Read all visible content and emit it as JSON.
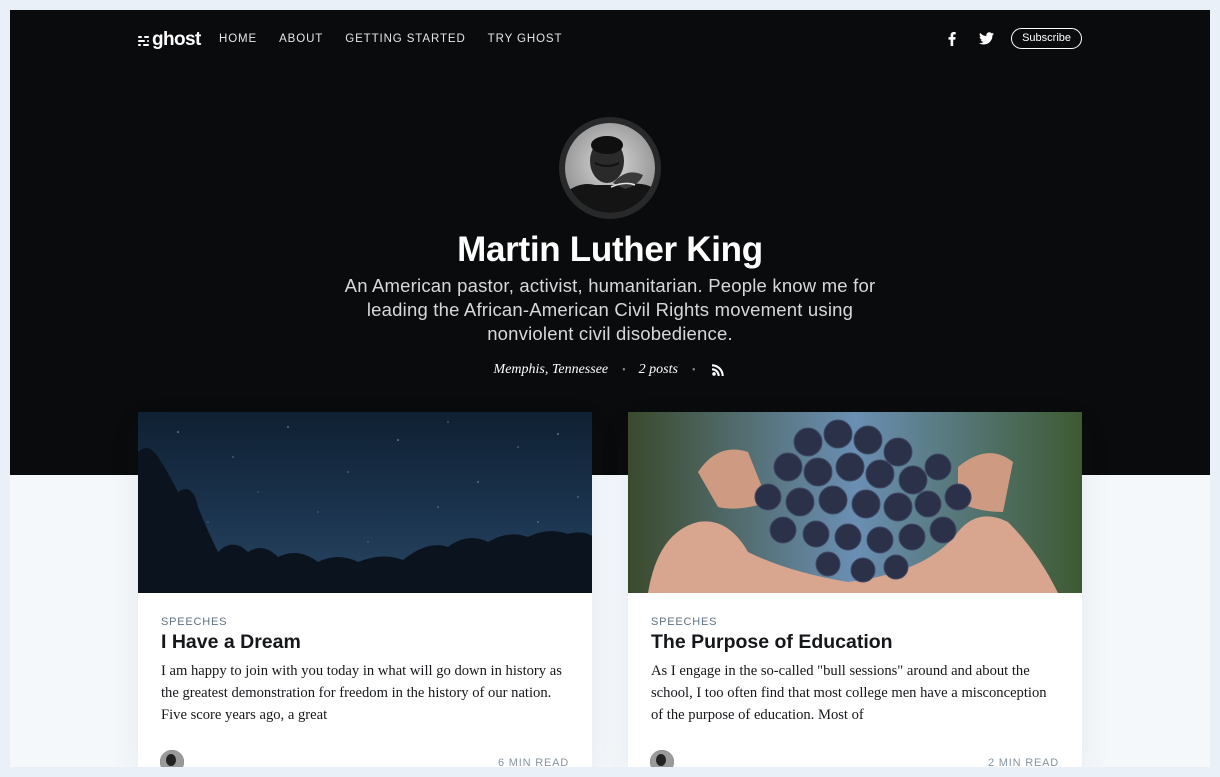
{
  "nav": {
    "logo_text": "ghost",
    "links": [
      "HOME",
      "ABOUT",
      "GETTING STARTED",
      "TRY GHOST"
    ],
    "subscribe_label": "Subscribe"
  },
  "author": {
    "name": "Martin Luther King",
    "bio": "An American pastor, activist, humanitarian. People know me for leading the African-American Civil Rights movement using nonviolent civil disobedience.",
    "location": "Memphis, Tennessee",
    "posts": "2 posts"
  },
  "posts": [
    {
      "tag": "SPEECHES",
      "title": "I Have a Dream",
      "excerpt": "I am happy to join with you today in what will go down in history as the greatest demonstration for freedom in the history of our nation. Five score years ago, a great",
      "read_time": "6 MIN READ"
    },
    {
      "tag": "SPEECHES",
      "title": "The Purpose of Education",
      "excerpt": "As I engage in the so-called \"bull sessions\" around and about the school, I too often find that most college men have a misconception of the purpose of education. Most of",
      "read_time": "2 MIN READ"
    }
  ],
  "icons": {
    "facebook": "facebook-icon",
    "twitter": "twitter-icon",
    "rss": "rss-icon"
  },
  "colors": {
    "hero_bg": "#0a0b0c",
    "page_bg": "#f4f8fb",
    "tag_color": "#5f7281"
  }
}
